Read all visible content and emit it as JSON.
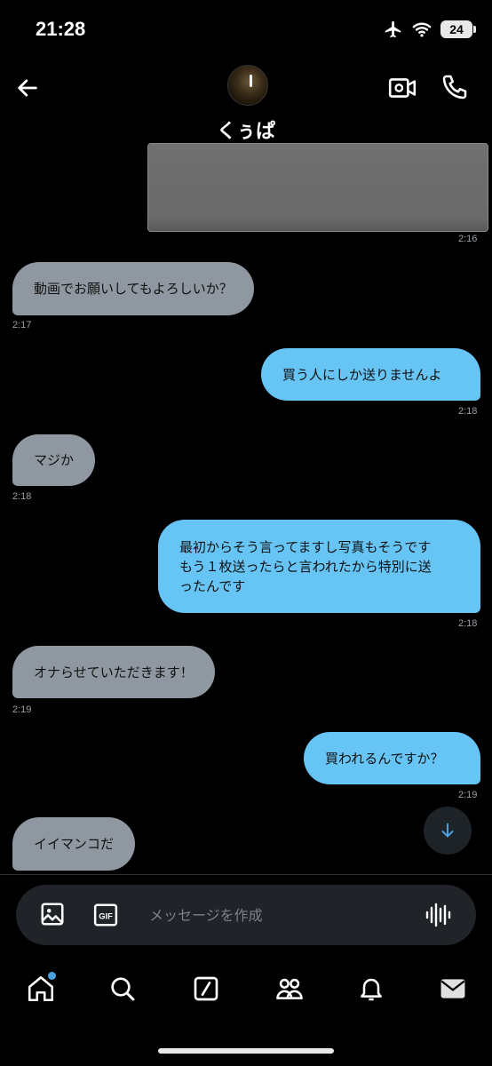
{
  "status_bar": {
    "time": "21:28",
    "battery": "24"
  },
  "header": {
    "contact_name": "くぅぱ"
  },
  "messages": [
    {
      "type": "image",
      "side": "out",
      "time": "2:16"
    },
    {
      "type": "text",
      "side": "in",
      "text": "動画でお願いしてもよろしいか？",
      "time": "2:17"
    },
    {
      "type": "text",
      "side": "out",
      "text": "買う人にしか送りませんよ",
      "time": "2:18"
    },
    {
      "type": "text",
      "side": "in",
      "text": "マジか",
      "time": "2:18"
    },
    {
      "type": "text",
      "side": "out",
      "text": "最初からそう言ってますし写真もそうです\nもう１枚送ったらと言われたから特別に送\nったんです",
      "time": "2:18"
    },
    {
      "type": "text",
      "side": "in",
      "text": "オナらせていただきます！",
      "time": "2:19"
    },
    {
      "type": "text",
      "side": "out",
      "text": "買われるんですか？",
      "time": "2:19"
    },
    {
      "type": "text",
      "side": "in",
      "text": "イイマンコだ"
    }
  ],
  "composer": {
    "placeholder": "メッセージを作成"
  },
  "colors": {
    "incoming_bubble": "#8f98a0",
    "outgoing_bubble": "#67c5f5",
    "accent": "#4aa3e0"
  },
  "icons": [
    "back-arrow-icon",
    "video-call-icon",
    "phone-icon",
    "scroll-down-arrow-icon",
    "image-icon",
    "gif-icon",
    "voice-wave-icon",
    "home-icon",
    "search-icon",
    "compose-icon",
    "communities-icon",
    "bell-icon",
    "mail-icon"
  ]
}
